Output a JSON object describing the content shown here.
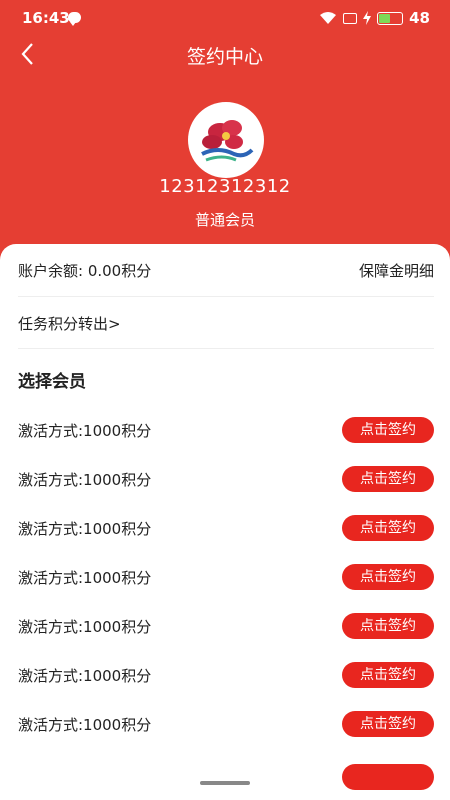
{
  "status_bar": {
    "time": "16:43",
    "battery": "48"
  },
  "nav": {
    "title": "签约中心"
  },
  "profile": {
    "user_id": "12312312312",
    "level": "普通会员"
  },
  "account": {
    "balance_label": "账户余额: 0.00积分",
    "guarantee_link": "保障金明细",
    "transfer_link": "任务积分转出>"
  },
  "plans_section": {
    "title": "选择会员"
  },
  "plans": [
    {
      "label": "激活方式:1000积分",
      "button": "点击签约"
    },
    {
      "label": "激活方式:1000积分",
      "button": "点击签约"
    },
    {
      "label": "激活方式:1000积分",
      "button": "点击签约"
    },
    {
      "label": "激活方式:1000积分",
      "button": "点击签约"
    },
    {
      "label": "激活方式:1000积分",
      "button": "点击签约"
    },
    {
      "label": "激活方式:1000积分",
      "button": "点击签约"
    },
    {
      "label": "激活方式:1000积分",
      "button": "点击签约"
    }
  ],
  "colors": {
    "brand": "#e53e33",
    "button": "#e8261f"
  }
}
